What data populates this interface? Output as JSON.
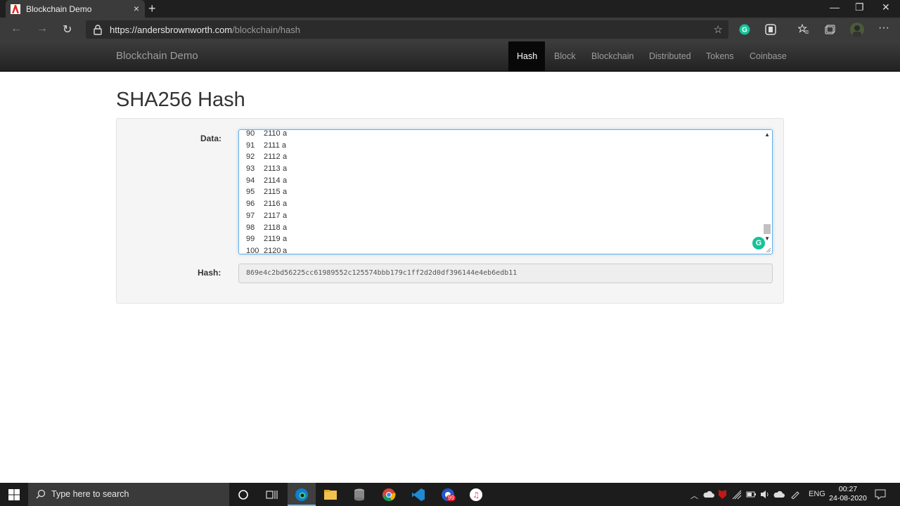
{
  "browser": {
    "tab_title": "Blockchain Demo",
    "close_glyph": "×",
    "new_tab_glyph": "+",
    "minimize_glyph": "—",
    "maximize_glyph": "❐",
    "window_close_glyph": "✕",
    "back_glyph": "←",
    "forward_glyph": "→",
    "refresh_glyph": "↻",
    "url_host": "https://andersbrownworth.com",
    "url_path": "/blockchain/hash",
    "favorite_glyph": "☆",
    "menu_glyph": "···"
  },
  "site": {
    "brand": "Blockchain Demo",
    "nav": [
      {
        "label": "Hash",
        "active": true
      },
      {
        "label": "Block",
        "active": false
      },
      {
        "label": "Blockchain",
        "active": false
      },
      {
        "label": "Distributed",
        "active": false
      },
      {
        "label": "Tokens",
        "active": false
      },
      {
        "label": "Coinbase",
        "active": false
      }
    ]
  },
  "main": {
    "title": "SHA256 Hash",
    "data_label": "Data:",
    "hash_label": "Hash:",
    "data_lines": [
      [
        "90",
        "2110",
        "a"
      ],
      [
        "91",
        "2111 a",
        ""
      ],
      [
        "92",
        "2112",
        "a"
      ],
      [
        "93",
        "2113",
        "a"
      ],
      [
        "94",
        "2114",
        "a"
      ],
      [
        "95",
        "2115",
        "a"
      ],
      [
        "96",
        "2116",
        "a"
      ],
      [
        "97",
        "2117",
        "a"
      ],
      [
        "98",
        "2118",
        "a"
      ],
      [
        "99",
        "2119",
        "a"
      ],
      [
        "100",
        "2120",
        "a"
      ]
    ],
    "hash_value": "869e4c2bd56225cc61989552c125574bbb179c1ff2d2d0df396144e4eb6edb11"
  },
  "taskbar": {
    "search_placeholder": "Type here to search",
    "language": "ENG",
    "time": "00:27",
    "date": "24-08-2020",
    "badge": "99"
  },
  "colors": {
    "accent_focus": "#66afe9",
    "grammarly": "#15c39a",
    "nav_bg": "#222222"
  }
}
